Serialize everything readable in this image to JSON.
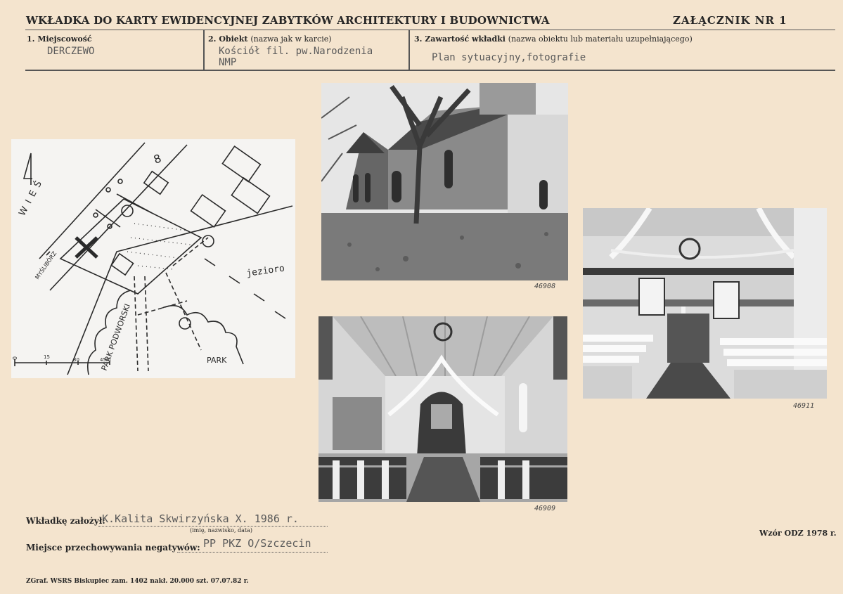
{
  "header": {
    "title": "WKŁADKA DO KARTY EWIDENCYJNEJ ZABYTKÓW ARCHITEKTURY I BUDOWNICTWA",
    "annex": "ZAŁĄCZNIK NR 1"
  },
  "fields": {
    "locality": {
      "label": "1. Miejscowość",
      "value": "DERCZEWO"
    },
    "object": {
      "label": "2. Obiekt",
      "label_note": "(nazwa jak w karcie)",
      "value_line1": "Kościół fil. pw.Narodzenia",
      "value_line2": "NMP"
    },
    "content": {
      "label": "3. Zawartość wkładki",
      "label_note": "(nazwa obiektu lub materiału uzupełniającego)",
      "value": "Plan sytuacyjny,fotografie"
    }
  },
  "map": {
    "labels": {
      "village": "WIEŚ",
      "number": "8",
      "road": "MYŚLIBÓRZ",
      "lake": "jezioro",
      "park_manor": "PARK PODWORSKI",
      "park": "PARK"
    },
    "scale": [
      "0",
      "15",
      "30",
      "45m"
    ]
  },
  "photos": [
    {
      "id": "exterior",
      "number": "46908"
    },
    {
      "id": "interior-altar",
      "number": "46909"
    },
    {
      "id": "interior-gallery",
      "number": "46911"
    }
  ],
  "footer": {
    "founder_label": "Wkładkę założył:",
    "founder_value": "K.Kalita Skwirzyńska X. 1986 r.",
    "founder_note": "(imię, nazwisko, data)",
    "storage_label": "Miejsce przechowywania negatywów:",
    "storage_value": "PP PKZ O/Szczecin",
    "form_model": "Wzór ODZ 1978 r.",
    "imprint": "ZGraf. WSRS Biskupiec zam. 1402 nakł. 20.000 szt. 07.07.82 r."
  }
}
